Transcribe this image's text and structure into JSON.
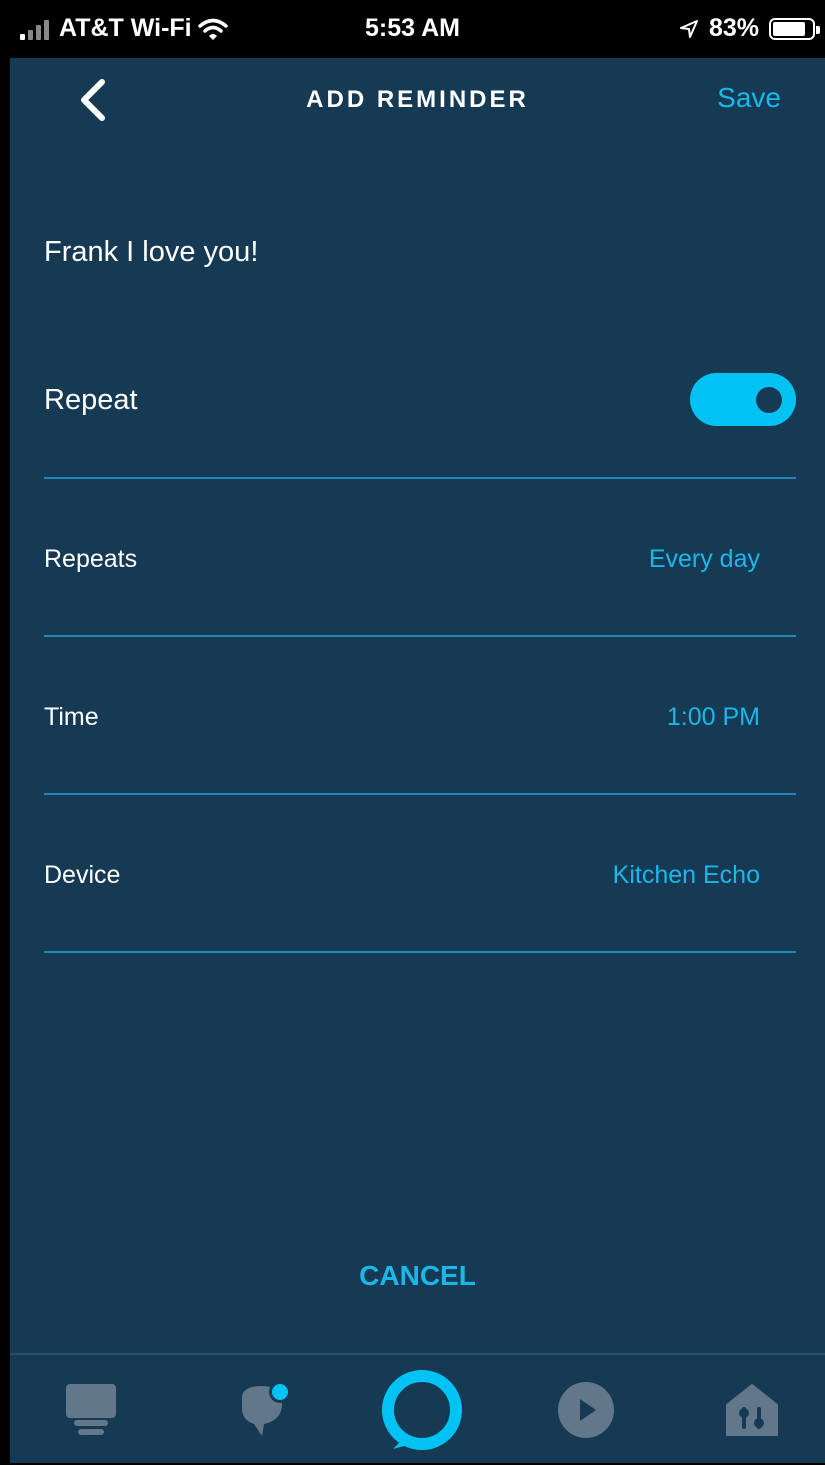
{
  "status_bar": {
    "carrier": "AT&T Wi-Fi",
    "time": "5:53 AM",
    "battery_percent": "83%",
    "battery_level": 0.83
  },
  "header": {
    "title": "ADD REMINDER",
    "save_label": "Save",
    "back_icon": "chevron-left-icon"
  },
  "reminder": {
    "text": "Frank I love you!"
  },
  "settings": {
    "repeat": {
      "label": "Repeat",
      "enabled": true
    },
    "repeats": {
      "label": "Repeats",
      "value": "Every day"
    },
    "time": {
      "label": "Time",
      "value": "1:00 PM"
    },
    "device": {
      "label": "Device",
      "value": "Kitchen Echo"
    }
  },
  "cancel_label": "CANCEL",
  "bottom_nav": [
    {
      "icon": "home-icon",
      "active": false
    },
    {
      "icon": "communicate-icon",
      "active": false,
      "badge": true
    },
    {
      "icon": "alexa-icon",
      "active": true
    },
    {
      "icon": "play-icon",
      "active": false
    },
    {
      "icon": "devices-icon",
      "active": false
    }
  ],
  "colors": {
    "background": "#173a54",
    "accent": "#1ab7ea",
    "toggle_on": "#00c3f4",
    "divider": "#1e86b8",
    "nav_icon": "#62788a"
  }
}
